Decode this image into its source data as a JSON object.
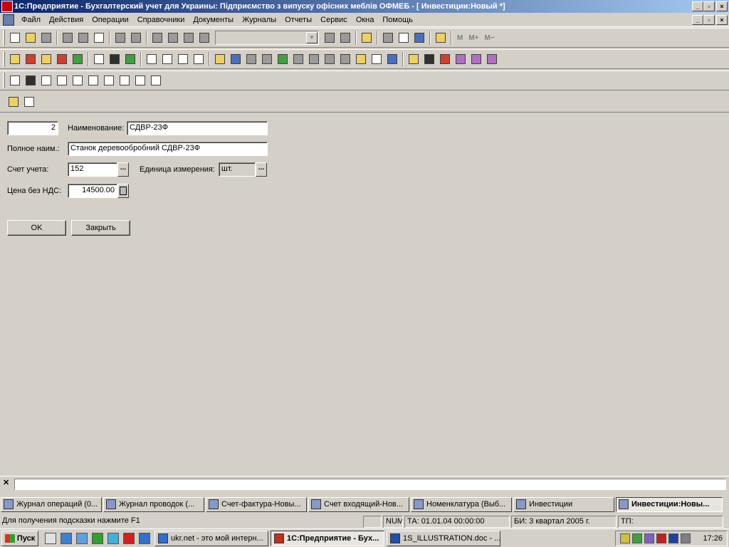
{
  "window": {
    "title": "1С:Предприятие - Бухгалтерский учет для Украины: Підприємство з випуску офісних меблів ОФМЕБ - [ Инвестиции:Новый *]",
    "controls": [
      "_",
      "▫",
      "×"
    ]
  },
  "menu": {
    "items": [
      "Файл",
      "Действия",
      "Операции",
      "Справочники",
      "Документы",
      "Журналы",
      "Отчеты",
      "Сервис",
      "Окна",
      "Помощь"
    ]
  },
  "toolbar": {
    "memory_buttons": [
      "M",
      "M+",
      "M−"
    ]
  },
  "form": {
    "code_value": "2",
    "name_label": "Наименование:",
    "name_value": "СДВР-23Ф",
    "fullname_label": "Полное наим.:",
    "fullname_value": "Станок деревообробний СДВР-23Ф",
    "account_label": "Счет учета:",
    "account_value": "152",
    "unit_label": "Единица измерения:",
    "unit_value": "шт.",
    "price_label": "Цена без НДС:",
    "price_value": "14500.00",
    "ok_label": "OK",
    "close_label": "Закрыть",
    "dots": "..."
  },
  "window_tabs": [
    {
      "label": "Журнал операций (0..."
    },
    {
      "label": "Журнал проводок (..."
    },
    {
      "label": "Счет-фактура-Новы..."
    },
    {
      "label": "Счет входящий-Нов..."
    },
    {
      "label": "Номенклатура (Выб..."
    },
    {
      "label": "Инвестиции"
    },
    {
      "label": "Инвестиции:Новы..."
    }
  ],
  "status": {
    "hint": "Для получения подсказки нажмите F1",
    "num": "NUM",
    "ta": "ТА: 01.01.04  00:00:00",
    "bi": "БИ: 3 квартал 2005 г.",
    "tp": "ТП:"
  },
  "taskbar": {
    "start_label": "Пуск",
    "tasks": [
      "ukr.net - это мой интерн...",
      "1С:Предприятие - Бух...",
      "1S_ILLUSTRATION.doc - ..."
    ],
    "clock": "17:26"
  }
}
